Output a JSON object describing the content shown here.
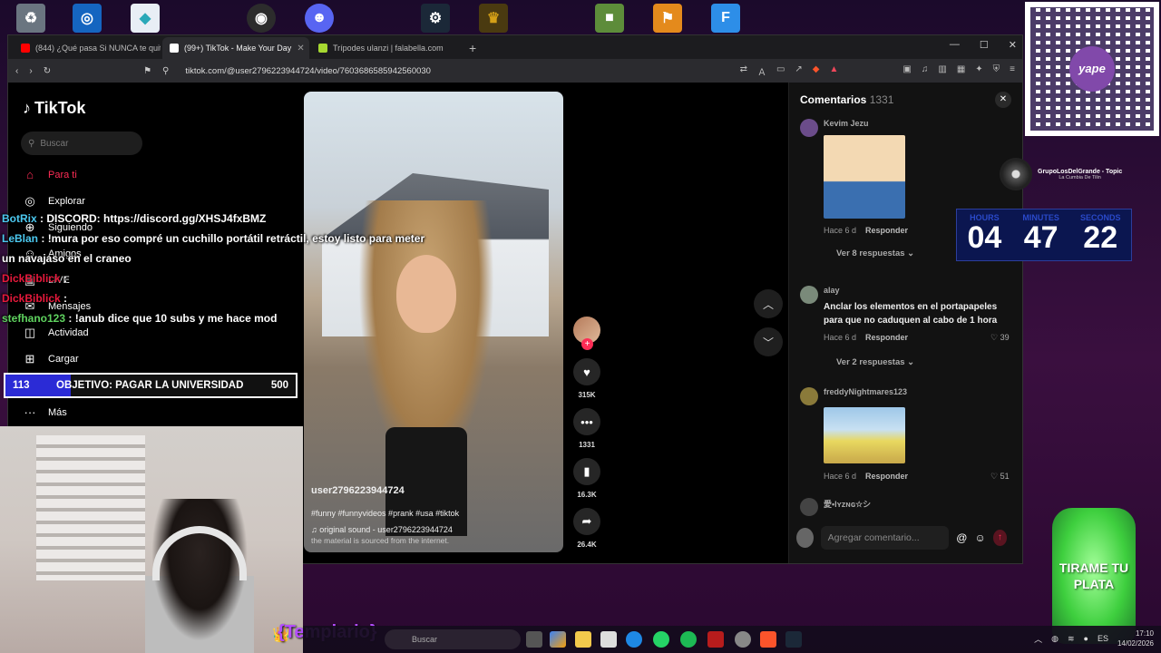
{
  "browser": {
    "tabs": [
      {
        "label": "(844) ¿Qué pasa Si NUNCA te quitas",
        "favicon_color": "#ff0000",
        "active": false
      },
      {
        "label": "(99+) TikTok - Make Your Day",
        "favicon_color": "#ffffff",
        "active": true
      },
      {
        "label": "Trípodes ulanzi | falabella.com",
        "favicon_color": "#a6d831",
        "active": false
      }
    ],
    "new_tab": "+",
    "url": "tiktok.com/@user2796223944724/video/7603686585942560030"
  },
  "tiktok": {
    "logo": "TikTok",
    "search_placeholder": "Buscar",
    "nav": [
      {
        "label": "Para ti",
        "icon": "home-icon"
      },
      {
        "label": "Explorar",
        "icon": "compass-icon"
      },
      {
        "label": "Siguiendo",
        "icon": "following-icon"
      },
      {
        "label": "Amigos",
        "icon": "friends-icon"
      },
      {
        "label": "LIVE",
        "icon": "live-icon"
      },
      {
        "label": "Mensajes",
        "icon": "message-icon"
      },
      {
        "label": "Actividad",
        "icon": "activity-icon"
      },
      {
        "label": "Cargar",
        "icon": "upload-icon"
      },
      {
        "label": "Más",
        "icon": "more-icon"
      }
    ],
    "video": {
      "username": "user2796223944724",
      "hashtags": "#funny #funnyvideos #prank #usa #tiktok",
      "sound": "original sound - user2796223944724",
      "note": "the material is sourced from the internet."
    },
    "actions": {
      "likes": "315K",
      "comments": "1331",
      "saves": "16.3K",
      "shares": "26.4K"
    },
    "comments_panel": {
      "title": "Comentarios",
      "count": "1331",
      "items": [
        {
          "user": "Kevim Jezu",
          "time": "Hace 6 d",
          "reply": "Responder",
          "replies": "Ver 8 respuestas"
        },
        {
          "user": "alay",
          "text": "Anclar los elementos en el portapapeles para que no caduquen al cabo de 1 hora",
          "time": "Hace 6 d",
          "reply": "Responder",
          "likes": "39",
          "replies": "Ver 2 respuestas"
        },
        {
          "user": "freddyNightmares123",
          "time": "Hace 6 d",
          "reply": "Responder",
          "likes": "51"
        },
        {
          "user": "愛•lʏᴢɴɢ☆シ"
        }
      ],
      "input_placeholder": "Agregar comentario..."
    }
  },
  "stream": {
    "chat": [
      {
        "user": "BotRix",
        "message": ": DISCORD: https://discord.gg/XHSJ4fxBMZ"
      },
      {
        "user": "LeBlan",
        "message": ": !mura por eso compré un cuchillo portátil retráctil, estoy listo para meter un navajaso en el craneo"
      },
      {
        "user": "DickBiblick",
        "message": ":"
      },
      {
        "user": "DickBiblick",
        "message": ":"
      },
      {
        "user": "stefhano123",
        "message": ": !anub dice que 10 subs y me hace mod"
      }
    ],
    "goal": {
      "current": "113",
      "label": "OBJETIVO: PAGAR LA UNIVERSIDAD",
      "target": "500",
      "progress": 0.226
    },
    "now_playing": {
      "title": "GrupoLosDelGrande - Topic",
      "song": "La Cumbia De Tilin"
    },
    "timer": {
      "hours_label": "HOURS",
      "minutes_label": "MINUTES",
      "seconds_label": "SECONDS",
      "hours": "04",
      "minutes": "47",
      "seconds": "22"
    },
    "donation_text": "TIRAME TU PLATA",
    "qr_brand": "yape",
    "badge_name": "{Templario}"
  },
  "taskbar": {
    "search_placeholder": "Buscar",
    "time": "17:10",
    "date": "14/02/2026",
    "lang": "ES"
  }
}
